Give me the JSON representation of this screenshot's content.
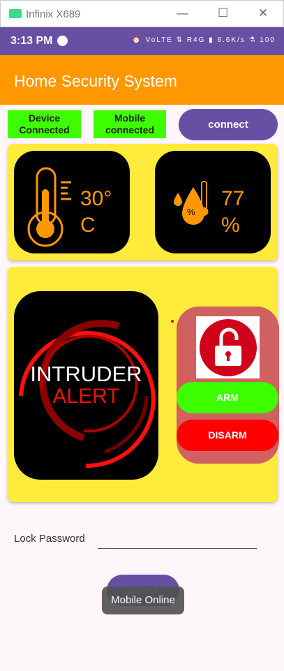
{
  "window": {
    "title": "Infinix X689",
    "minimize": "—",
    "maximize": "☐",
    "close": "✕"
  },
  "status_bar": {
    "time": "3:13 PM",
    "icons": "⏰ VoLTE ⇅ R4G ▮ 6.6K/s ⚗ 100"
  },
  "app_bar": {
    "title": "Home Security System",
    "color": "#ff9800"
  },
  "connection": {
    "device": "Device Connected",
    "mobile": "Mobile connected",
    "connect_label": "connect"
  },
  "sensors": {
    "temperature": {
      "value": "30°",
      "unit": "C"
    },
    "humidity": {
      "value": "77",
      "unit": "%"
    }
  },
  "alert": {
    "line1": "INTRUDER",
    "line2": "ALERT"
  },
  "controls": {
    "lock_state": "unlocked",
    "arm_label": "ARM",
    "disarm_label": "DISARM"
  },
  "lock": {
    "password_label": "Lock Password",
    "password_value": "",
    "unlock_label": "Unlock"
  },
  "toast": "Mobile Online"
}
